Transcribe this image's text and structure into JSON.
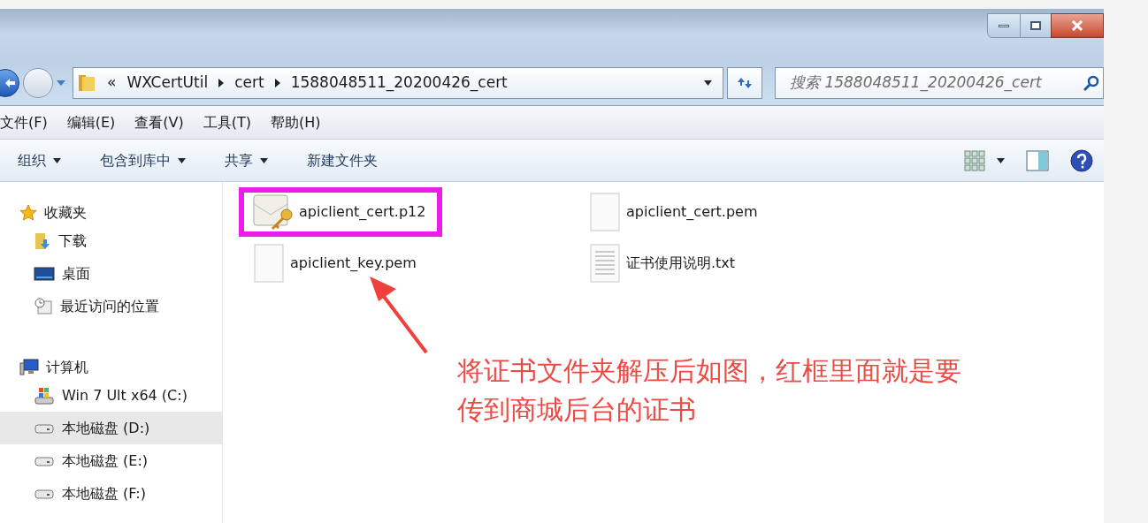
{
  "window": {
    "buttons": [
      {
        "kind": "minimize"
      },
      {
        "kind": "maximize"
      },
      {
        "kind": "close"
      }
    ]
  },
  "address": {
    "overflow": "«",
    "path": [
      "WXCertUtil",
      "cert",
      "1588048511_20200426_cert"
    ]
  },
  "search": {
    "placeholder": "搜索 1588048511_20200426_cert"
  },
  "menu": [
    "文件(F)",
    "编辑(E)",
    "查看(V)",
    "工具(T)",
    "帮助(H)"
  ],
  "toolbar": [
    {
      "label": "组织",
      "dropdown": true
    },
    {
      "label": "包含到库中",
      "dropdown": true
    },
    {
      "label": "共享",
      "dropdown": true
    },
    {
      "label": "新建文件夹",
      "dropdown": false
    }
  ],
  "sidebar": [
    {
      "label": "收藏夹",
      "kind": "star",
      "children": [
        {
          "label": "下载",
          "kind": "download",
          "selected": false
        },
        {
          "label": "桌面",
          "kind": "desktop",
          "selected": false
        },
        {
          "label": "最近访问的位置",
          "kind": "recent",
          "selected": false
        }
      ]
    },
    {
      "label": "计算机",
      "kind": "computer",
      "children": [
        {
          "label": "Win 7 Ult x64 (C:)",
          "kind": "system",
          "selected": false
        },
        {
          "label": "本地磁盘 (D:)",
          "kind": "drive",
          "selected": true
        },
        {
          "label": "本地磁盘 (E:)",
          "kind": "drive",
          "selected": false
        },
        {
          "label": "本地磁盘 (F:)",
          "kind": "drive",
          "selected": false
        }
      ]
    }
  ],
  "files": [
    {
      "name": "apiclient_cert.p12",
      "kind": "certificate",
      "highlighted": true
    },
    {
      "name": "apiclient_cert.pem",
      "kind": "blank",
      "highlighted": false
    },
    {
      "name": "apiclient_key.pem",
      "kind": "blank",
      "highlighted": false
    },
    {
      "name": "证书使用说明.txt",
      "kind": "text",
      "highlighted": false
    }
  ],
  "annotation": {
    "lines": [
      "将证书文件夹解压后如图，红框里面就是要",
      "传到商城后台的证书"
    ]
  }
}
